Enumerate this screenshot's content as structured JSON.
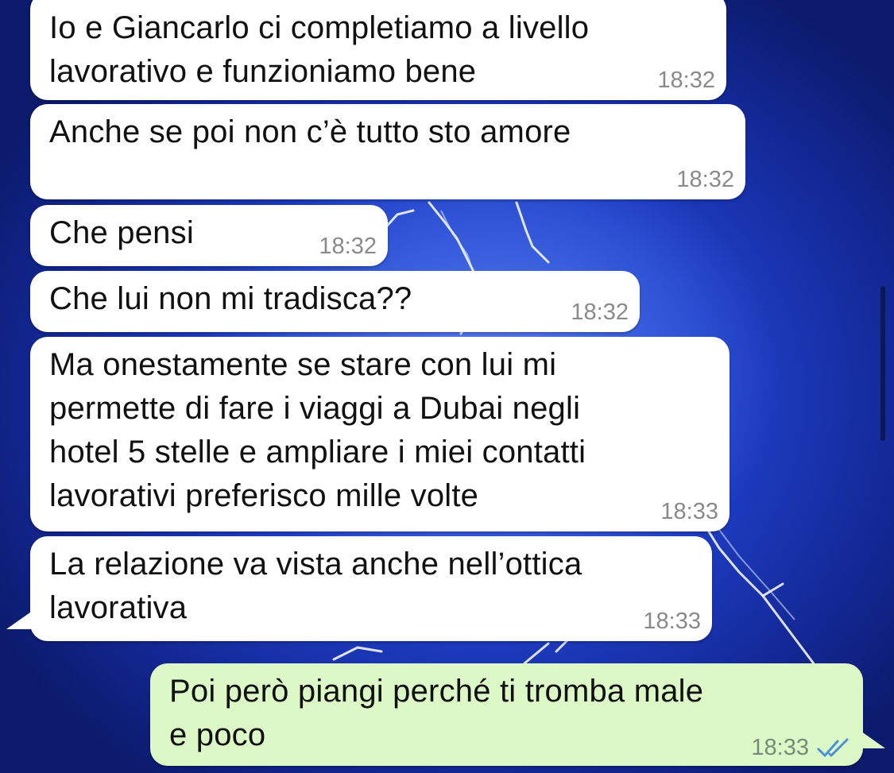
{
  "chat": {
    "messages": [
      {
        "direction": "incoming",
        "text": "Io e Giancarlo ci completiamo a livello\nlavorativo e funzioniamo bene",
        "time": "18:32"
      },
      {
        "direction": "incoming",
        "text": "Anche se poi non c’è tutto sto amore",
        "time": "18:32"
      },
      {
        "direction": "incoming",
        "text": "Che pensi",
        "time": "18:32"
      },
      {
        "direction": "incoming",
        "text": "Che lui non mi tradisca??",
        "time": "18:32"
      },
      {
        "direction": "incoming",
        "text": "Ma onestamente se stare con lui mi\npermette di fare i viaggi a Dubai negli\nhotel 5 stelle e ampliare i miei contatti\nlavorativi preferisco mille volte",
        "time": "18:33"
      },
      {
        "direction": "incoming",
        "text": "La relazione va vista anche nell’ottica\nlavorativa",
        "time": "18:33"
      },
      {
        "direction": "outgoing",
        "text": "Poi però piangi perché ti tromba male\ne poco",
        "time": "18:33",
        "status": "read",
        "status_icon": "double-check-icon"
      }
    ]
  },
  "theme": {
    "incoming_bubble": "#ffffff",
    "outgoing_bubble": "#dcf8c6",
    "wallpaper": "#1f3fc8",
    "read_check": "#4a90d9"
  }
}
